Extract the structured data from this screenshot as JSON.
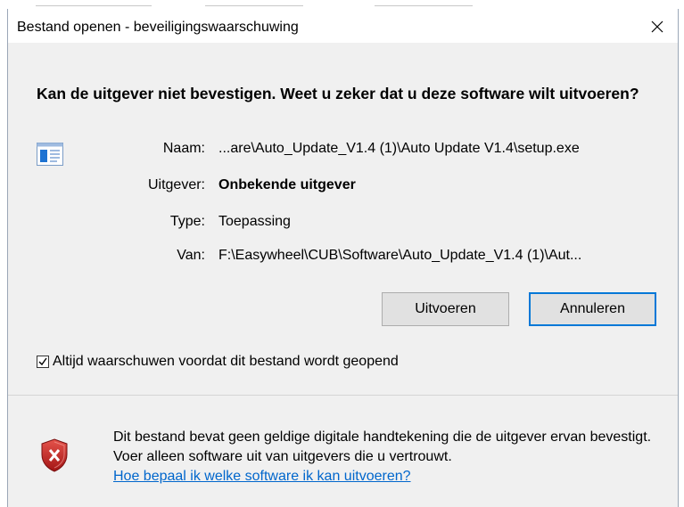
{
  "dialog": {
    "title": "Bestand openen - beveiligingswaarschuwing",
    "question": "Kan de uitgever niet bevestigen. Weet u zeker dat u deze software wilt uitvoeren?",
    "icons": {
      "close": "close-icon",
      "app": "application-icon",
      "warning": "shield-error-icon",
      "checkbox": "checkmark-icon"
    },
    "details": [
      {
        "label": "Naam:",
        "value": "...are\\Auto_Update_V1.4 (1)\\Auto Update V1.4\\setup.exe",
        "bold": false
      },
      {
        "label": "Uitgever:",
        "value": "Onbekende uitgever",
        "bold": true
      },
      {
        "label": "Type:",
        "value": "Toepassing",
        "bold": false
      },
      {
        "label": "Van:",
        "value": "F:\\Easywheel\\CUB\\Software\\Auto_Update_V1.4 (1)\\Aut...",
        "bold": false
      }
    ],
    "buttons": {
      "run": "Uitvoeren",
      "cancel": "Annuleren"
    },
    "always_warn": {
      "label": "Altijd waarschuwen voordat dit bestand wordt geopend",
      "checked": true
    },
    "footer": {
      "text": "Dit bestand bevat geen geldige digitale handtekening die de uitgever ervan bevestigt. Voer alleen software uit van uitgevers die u vertrouwt.",
      "link": "Hoe bepaal ik welke software ik kan uitvoeren?"
    },
    "colors": {
      "accent": "#0078d7",
      "link": "#0066cc",
      "shield": "#c62828"
    }
  }
}
